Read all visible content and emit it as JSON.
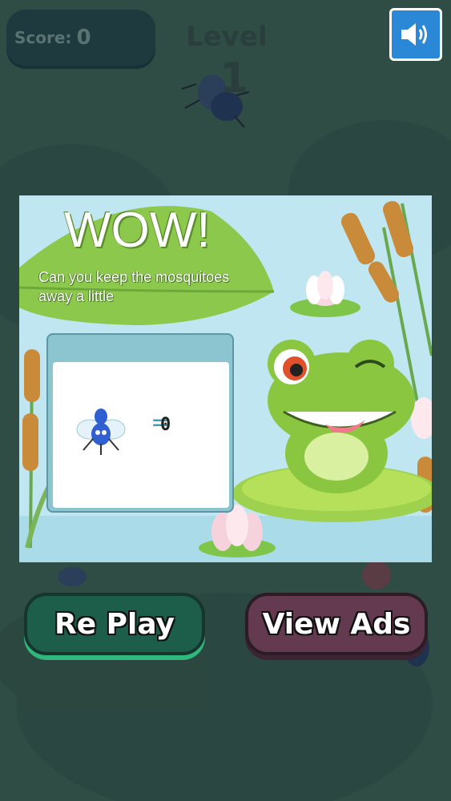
{
  "hud": {
    "score_label": "Score:",
    "score_value": "0",
    "level_label": "Level",
    "level_value": "1",
    "sound_icon": "speaker-icon"
  },
  "popup": {
    "headline": "WOW!",
    "subtitle": "Can you keep the mosquitoes away a little",
    "equals_sign": "=",
    "mosquito_count": "0",
    "mosquito_icon": "mosquito-icon"
  },
  "buttons": {
    "replay_label": "Re Play",
    "view_ads_label": "View Ads"
  },
  "colors": {
    "background": "#2f4c45",
    "popup_sky": "#bfe6f1",
    "replay_button": "#1d5e4b",
    "view_ads_button": "#633a50",
    "sound_button": "#2a88d6"
  }
}
